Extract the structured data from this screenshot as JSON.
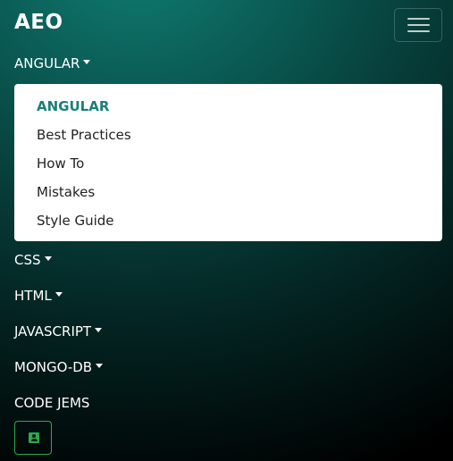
{
  "brand": "AEO",
  "nav": {
    "angular": "ANGULAR",
    "css": "CSS",
    "html": "HTML",
    "javascript": "JAVASCRIPT",
    "mongodb": "MONGO-DB",
    "codejems": "CODE JEMS"
  },
  "dropdown": {
    "items": [
      "ANGULAR",
      "Best Practices",
      "How To",
      "Mistakes",
      "Style Guide"
    ]
  },
  "colors": {
    "accent": "#1a7f7a",
    "contact": "#2fa84f"
  },
  "icons": {
    "toggler": "menu-icon",
    "contact": "contact-card-icon"
  }
}
